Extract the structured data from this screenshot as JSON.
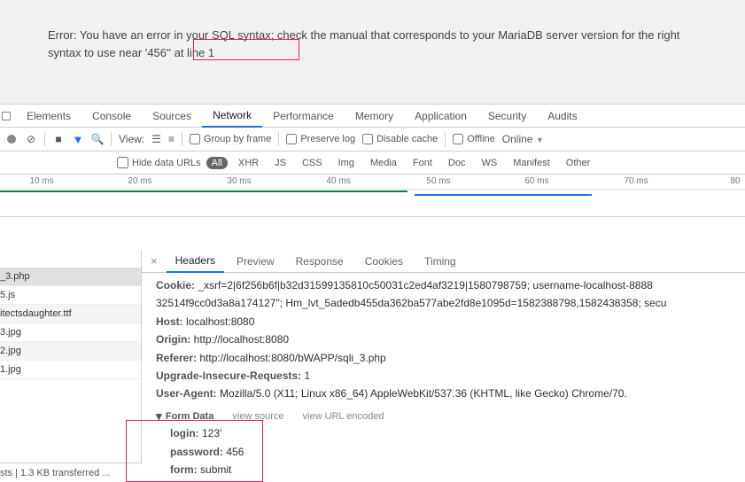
{
  "page": {
    "error_prefix": "Error: You have an error in your SQL syntax; check the manual that corresponds to your MariaDB server version for the right syntax to use near '456'' at line 1"
  },
  "tabs": {
    "elements": "Elements",
    "console": "Console",
    "sources": "Sources",
    "network": "Network",
    "performance": "Performance",
    "memory": "Memory",
    "application": "Application",
    "security": "Security",
    "audits": "Audits"
  },
  "toolbar": {
    "view_label": "View:",
    "group_by_frame": "Group by frame",
    "preserve_log": "Preserve log",
    "disable_cache": "Disable cache",
    "offline": "Offline",
    "online": "Online"
  },
  "filterbar": {
    "hide_data_urls": "Hide data URLs",
    "all": "All",
    "xhr": "XHR",
    "js": "JS",
    "css": "CSS",
    "img": "Img",
    "media": "Media",
    "font": "Font",
    "doc": "Doc",
    "ws": "WS",
    "manifest": "Manifest",
    "other": "Other"
  },
  "timeline": {
    "ticks": [
      "10 ms",
      "20 ms",
      "30 ms",
      "40 ms",
      "50 ms",
      "60 ms",
      "70 ms",
      "80"
    ]
  },
  "requests": [
    "_3.php",
    "5.js",
    "itectsdaughter.ttf",
    "3.jpg",
    "2.jpg",
    "1.jpg"
  ],
  "footer": "sts   |  1.3 KB transferred ...",
  "detail_tabs": {
    "headers": "Headers",
    "preview": "Preview",
    "response": "Response",
    "cookies": "Cookies",
    "timing": "Timing"
  },
  "headers": {
    "cookie_k": "Cookie:",
    "cookie_v": "_xsrf=2|6f256b6f|b32d31599135810c50031c2ed4af3219|1580798759; username-localhost-8888",
    "cookie_v2": "32514f9cc0d3a8a174127\"; Hm_lvt_5adedb455da362ba577abe2fd8e1095d=1582388798,1582438358; secu",
    "host_k": "Host:",
    "host_v": "localhost:8080",
    "origin_k": "Origin:",
    "origin_v": "http://localhost:8080",
    "referer_k": "Referer:",
    "referer_v": "http://localhost:8080/bWAPP/sqli_3.php",
    "uir_k": "Upgrade-Insecure-Requests:",
    "uir_v": "1",
    "ua_k": "User-Agent:",
    "ua_v": "Mozilla/5.0 (X11; Linux x86_64) AppleWebKit/537.36 (KHTML, like Gecko) Chrome/70."
  },
  "form_section": {
    "title": "Form Data",
    "view_source": "view source",
    "view_url_encoded": "view URL encoded",
    "login_k": "login:",
    "login_v": "123'",
    "password_k": "password:",
    "password_v": "456",
    "form_k": "form:",
    "form_v": "submit"
  }
}
